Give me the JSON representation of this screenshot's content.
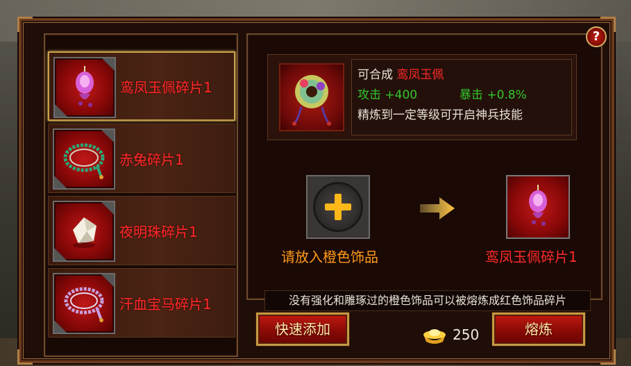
{
  "fragments": [
    {
      "name": "鸾凤玉佩碎片1",
      "icon": "jade-pendant-icon",
      "selected": true
    },
    {
      "name": "赤兔碎片1",
      "icon": "bead-necklace-icon",
      "selected": false
    },
    {
      "name": "夜明珠碎片1",
      "icon": "pearl-icon",
      "selected": false
    },
    {
      "name": "汗血宝马碎片1",
      "icon": "bead-necklace-icon",
      "selected": false
    }
  ],
  "synthesis": {
    "prefix": "可合成",
    "item_name": "鸾凤玉佩",
    "attack_label": "攻击",
    "attack_value": "+400",
    "crit_label": "暴击",
    "crit_value": "+0.8%",
    "description": "精炼到一定等级可开启神兵技能",
    "icon": "jade-pendant-icon"
  },
  "input_slot": {
    "label": "请放入橙色饰品",
    "icon": "plus-icon"
  },
  "result_slot": {
    "label": "鸾凤玉佩碎片1",
    "icon": "jade-pendant-icon"
  },
  "hint_text": "没有强化和雕琢过的橙色饰品可以被熔炼成红色饰品碎片",
  "buttons": {
    "quick_add": "快速添加",
    "smelt": "熔炼",
    "help": "?"
  },
  "currency": {
    "icon": "gold-ingot-icon",
    "amount": "250"
  },
  "colors": {
    "rarity_red": "#ff2a2a",
    "stat_green": "#31c62b",
    "slot_orange": "#ff9a1a",
    "frame_gold": "#c69a44"
  }
}
